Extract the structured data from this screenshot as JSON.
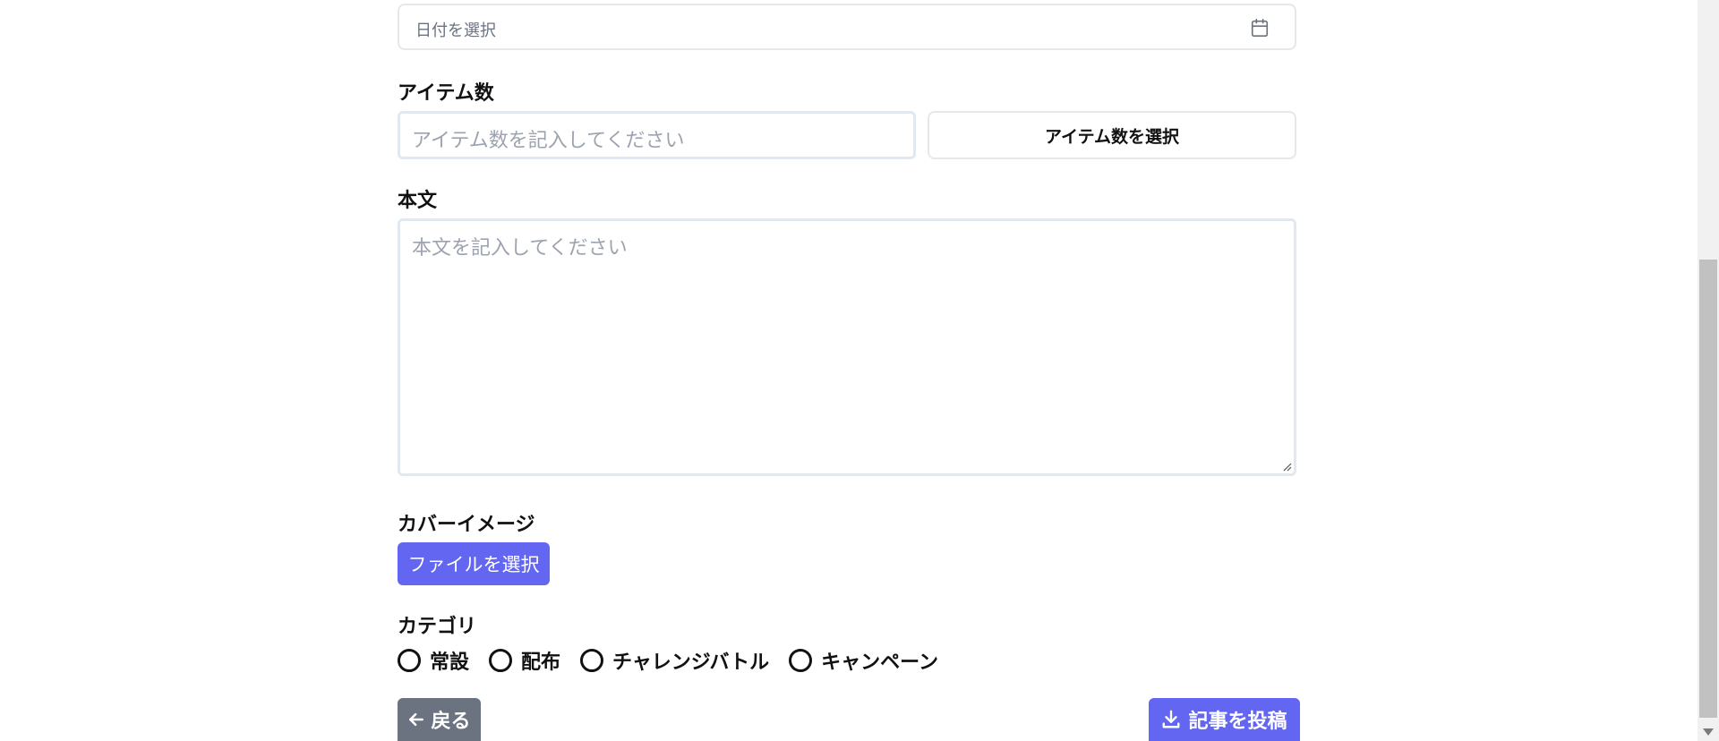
{
  "date": {
    "placeholder": "日付を選択",
    "icon": "calendar-icon"
  },
  "item_count": {
    "label": "アイテム数",
    "input_placeholder": "アイテム数を記入してください",
    "select_label": "アイテム数を選択"
  },
  "body": {
    "label": "本文",
    "placeholder": "本文を記入してください"
  },
  "cover": {
    "label": "カバーイメージ",
    "button_label": "ファイルを選択"
  },
  "category": {
    "label": "カテゴリ",
    "options": [
      "常設",
      "配布",
      "チャレンジバトル",
      "キャンペーン"
    ]
  },
  "actions": {
    "back_label": "戻る",
    "back_icon": "arrow-left-icon",
    "post_label": "記事を投稿",
    "post_icon": "download-icon"
  },
  "colors": {
    "accent": "#6366f1",
    "secondary": "#6b7280",
    "border": "#e2e8f0"
  }
}
